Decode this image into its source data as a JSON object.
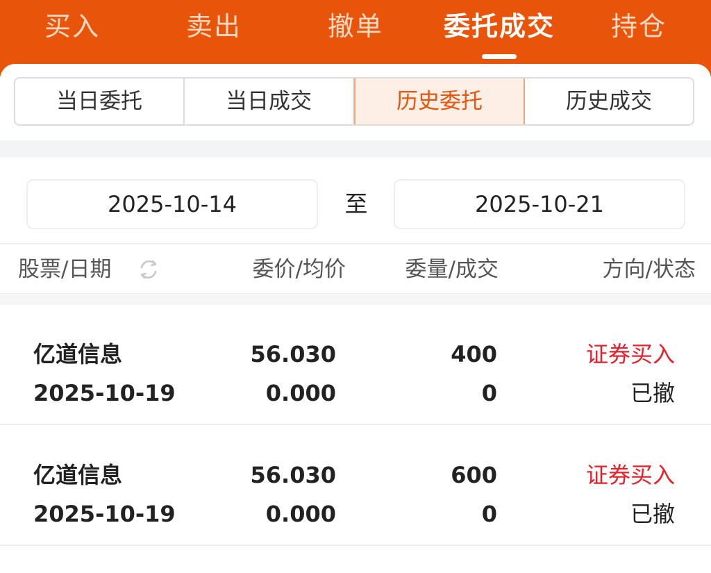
{
  "colors": {
    "accent": "#e8550a",
    "buy_red": "#e8202a"
  },
  "top_tabs": [
    {
      "label": "买入"
    },
    {
      "label": "卖出"
    },
    {
      "label": "撤单"
    },
    {
      "label": "委托成交",
      "active": true
    },
    {
      "label": "持仓"
    }
  ],
  "segments": [
    {
      "label": "当日委托"
    },
    {
      "label": "当日成交"
    },
    {
      "label": "历史委托",
      "active": true
    },
    {
      "label": "历史成交"
    }
  ],
  "date_range": {
    "start": "2025-10-14",
    "separator": "至",
    "end": "2025-10-21"
  },
  "table": {
    "headers": {
      "col1": "股票/日期",
      "col2": "委价/均价",
      "col3": "委量/成交",
      "col4": "方向/状态"
    },
    "refresh_icon": "refresh-icon",
    "rows": [
      {
        "name": "亿道信息",
        "date": "2025-10-19",
        "order_price": "56.030",
        "avg_price": "0.000",
        "order_qty": "400",
        "filled_qty": "0",
        "direction": "证券买入",
        "status": "已撤"
      },
      {
        "name": "亿道信息",
        "date": "2025-10-19",
        "order_price": "56.030",
        "avg_price": "0.000",
        "order_qty": "600",
        "filled_qty": "0",
        "direction": "证券买入",
        "status": "已撤"
      }
    ]
  }
}
